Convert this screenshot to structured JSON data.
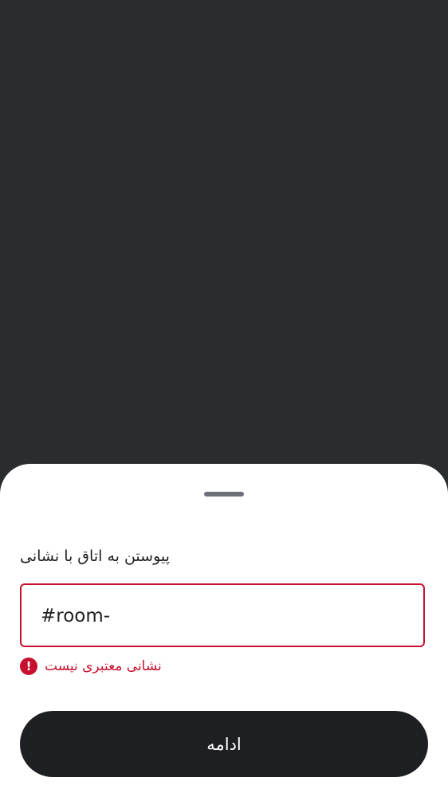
{
  "sheet": {
    "title": "پیوستن به اتاق با نشانی",
    "address_input": {
      "value": "#room-"
    },
    "error": {
      "icon": "error-icon",
      "icon_glyph": "!",
      "message": "نشانی معتبری نیست"
    },
    "continue_label": "ادامه"
  },
  "colors": {
    "backdrop": "#2b2c2e",
    "error": "#c8102e",
    "button": "#1e1f23"
  }
}
